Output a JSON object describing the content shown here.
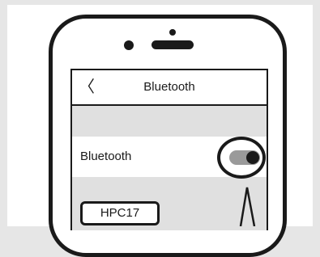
{
  "nav": {
    "back_icon": "chevron-left-icon",
    "back_glyph": "〈",
    "title": "Bluetooth"
  },
  "settings": {
    "bluetooth_label": "Bluetooth",
    "bluetooth_enabled": true
  },
  "devices": [
    {
      "label": "HPC17"
    }
  ],
  "colors": {
    "outline": "#1a1a1a",
    "screen_bg": "#e0e0e0",
    "toggle_track": "#9a9a9a"
  }
}
